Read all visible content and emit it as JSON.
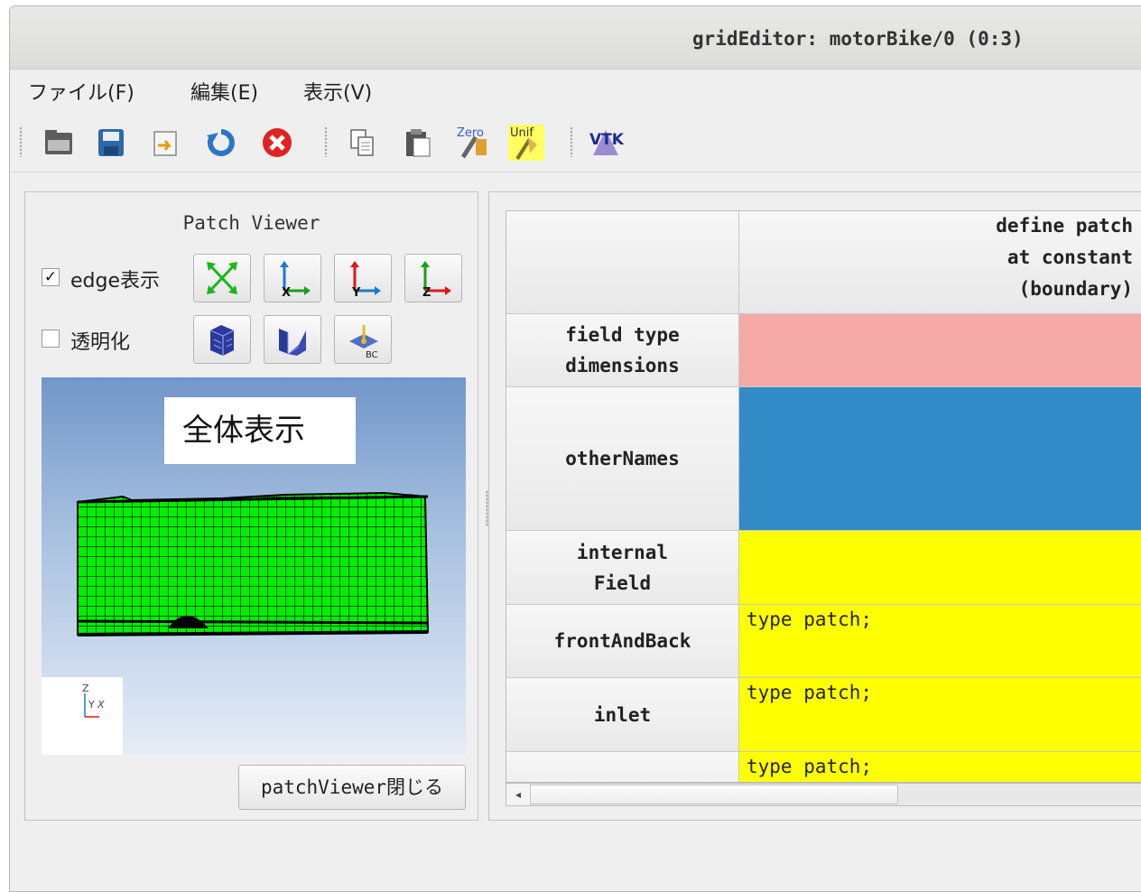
{
  "window": {
    "title": "gridEditor: motorBike/0 (0:3)"
  },
  "menu": [
    "ファイル(F)",
    "編集(E)",
    "表示(V)"
  ],
  "toolbar": {
    "buttons": [
      "open-folder-icon",
      "save-icon",
      "export-icon",
      "reload-icon",
      "cancel-icon",
      "copy-icon",
      "paste-icon",
      "zero-icon",
      "uniform-icon",
      "vtk-icon"
    ],
    "zero_label": "Zero",
    "unif_label": "Unif",
    "vtk_label": "VTK"
  },
  "patch_viewer": {
    "title": "Patch Viewer",
    "edge": {
      "label": "edge表示",
      "checked": true,
      "mark": "✓"
    },
    "transparent": {
      "label": "透明化",
      "checked": false,
      "mark": ""
    },
    "bc_label": "BC",
    "viewport_label": "全体表示",
    "axes": {
      "z": "Z",
      "y": "Y",
      "x": "X"
    },
    "close_button": "patchViewer閉じる"
  },
  "table": {
    "column_header": [
      "define patch",
      "at constant",
      "(boundary)"
    ],
    "rows": [
      {
        "header": [
          "field type",
          "dimensions"
        ],
        "value": "",
        "color": "#f4a9a6"
      },
      {
        "header": [
          "otherNames"
        ],
        "value": "",
        "color": "#328ac7"
      },
      {
        "header": [
          "internal",
          "Field"
        ],
        "value": "",
        "color": "#ffff00"
      },
      {
        "header": [
          "frontAndBack"
        ],
        "value": "type patch;",
        "color": "#ffff00"
      },
      {
        "header": [
          "inlet"
        ],
        "value": "type patch;",
        "color": "#ffff00"
      },
      {
        "header": [
          ""
        ],
        "value": "type patch;",
        "color": "#ffff00"
      }
    ],
    "scroll_left": "◂"
  },
  "colors": {
    "mesh": "#00ff00",
    "accent_blue": "#328ac7",
    "pink": "#f4a9a6",
    "yellow": "#ffff00"
  }
}
